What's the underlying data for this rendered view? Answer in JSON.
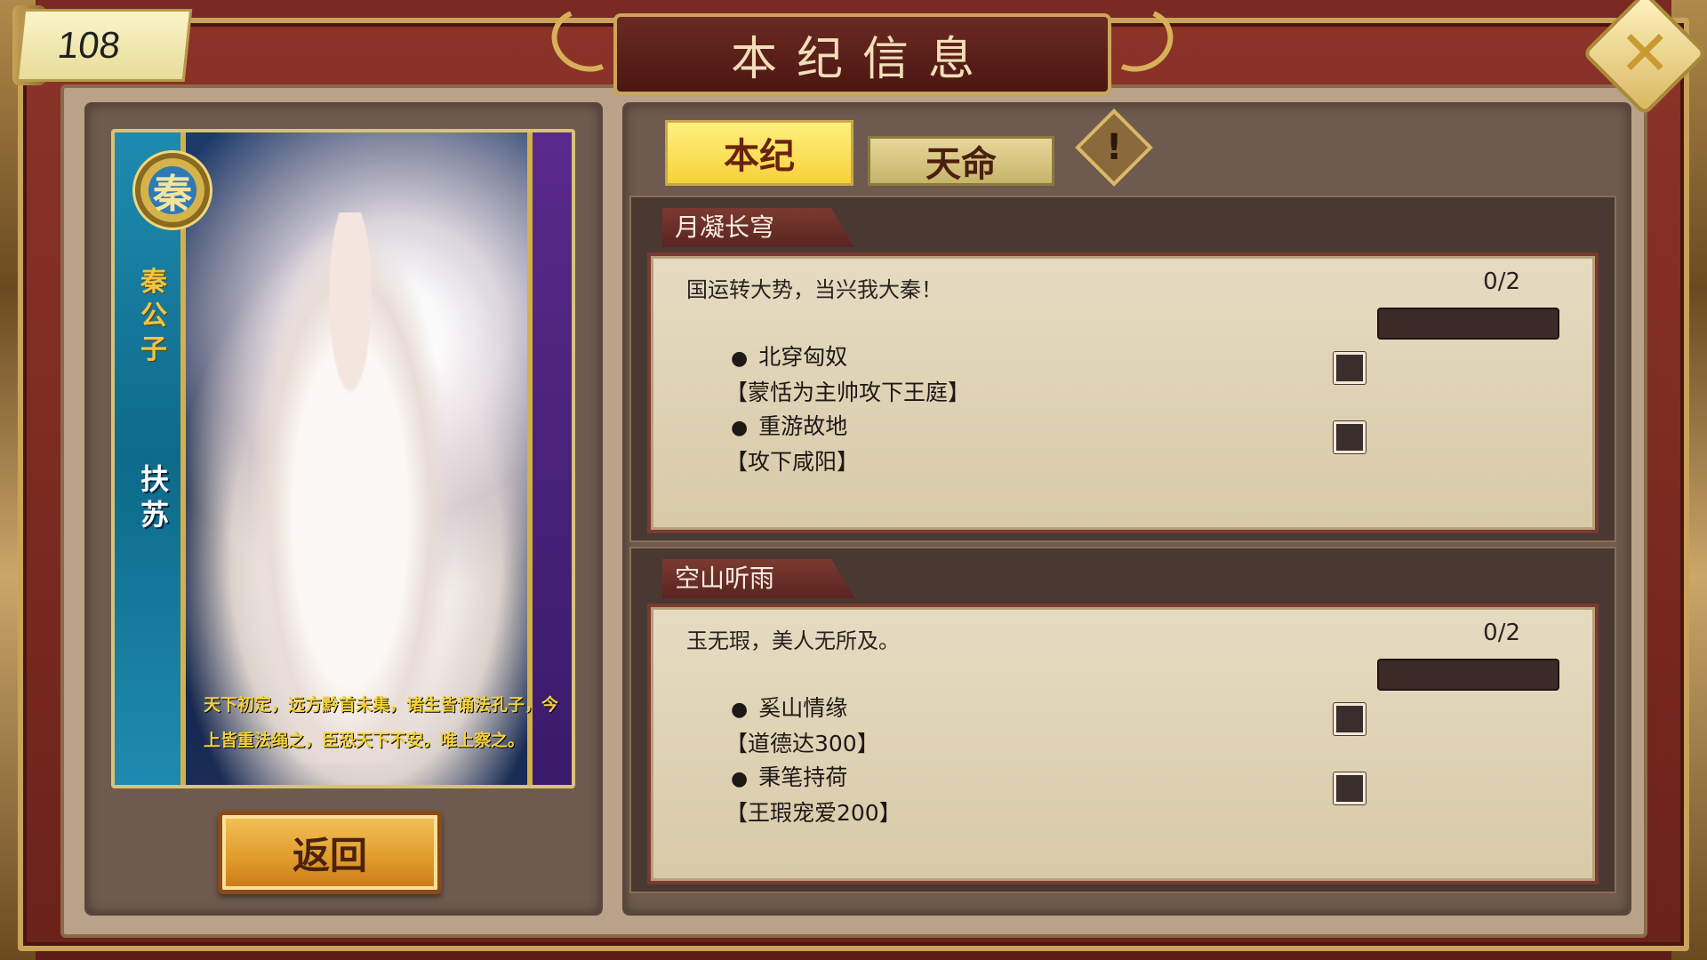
{
  "level": "108",
  "title": "本纪信息",
  "tabs": {
    "benji": "本纪",
    "tianming": "天命",
    "active": "benji"
  },
  "hero": {
    "faction_glyph": "秦",
    "title": "秦公子",
    "name": "扶苏",
    "quote": "天下初定，远方黔首未集，诸生皆诵法孔子，今上皆重法绳之，臣恐天下不安。唯上察之。"
  },
  "back_button": "返回",
  "sections": [
    {
      "header": "月凝长穹",
      "description": "国运转大势，当兴我大秦！",
      "progress_text": "0/2",
      "progress": 0,
      "goals": [
        {
          "title": "北穿匈奴",
          "condition": "【蒙恬为主帅攻下王庭】"
        },
        {
          "title": "重游故地",
          "condition": "【攻下咸阳】"
        }
      ]
    },
    {
      "header": "空山听雨",
      "description": "玉无瑕，美人无所及。",
      "progress_text": "0/2",
      "progress": 0,
      "goals": [
        {
          "title": "奚山情缘",
          "condition": "【道德达300】"
        },
        {
          "title": "秉笔持荷",
          "condition": "【王瑕宠爱200】"
        }
      ]
    }
  ],
  "icons": {
    "close": "close-icon",
    "info": "exclamation-icon",
    "bullet": "●"
  },
  "colors": {
    "frame": "#8c3328",
    "gold": "#caa65a",
    "tab_active": "#f6d23a",
    "progress_bg": "#3c2a26"
  }
}
